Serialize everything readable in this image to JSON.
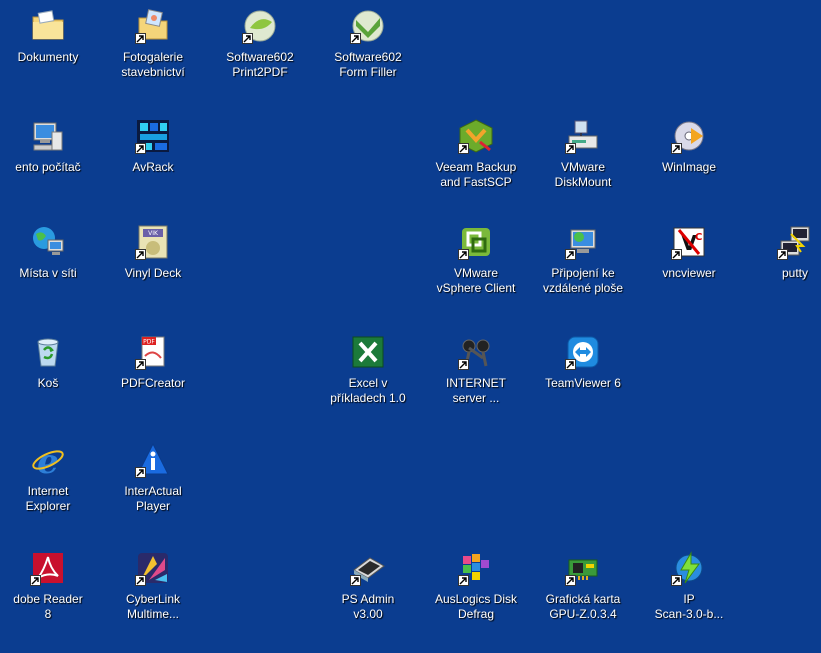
{
  "desktop": {
    "background": "#0b3d90",
    "icons": [
      {
        "id": "dokumenty",
        "label": "Dokumenty",
        "icon": "folder-icon",
        "shortcut": false
      },
      {
        "id": "fotogalerie",
        "label": "Fotogalerie\nstavebnictví",
        "icon": "photo-folder-icon",
        "shortcut": true
      },
      {
        "id": "sw602-print",
        "label": "Software602\nPrint2PDF",
        "icon": "software602-print-icon",
        "shortcut": true
      },
      {
        "id": "sw602-form",
        "label": "Software602\nForm Filler",
        "icon": "software602-form-icon",
        "shortcut": true
      },
      {
        "id": "tento-pocitac",
        "label": "ento počítač",
        "icon": "my-computer-icon",
        "shortcut": false
      },
      {
        "id": "avrack",
        "label": "AvRack",
        "icon": "avrack-icon",
        "shortcut": true
      },
      {
        "id": "veeam",
        "label": "Veeam Backup\nand FastSCP",
        "icon": "veeam-icon",
        "shortcut": true
      },
      {
        "id": "vmware-diskmount",
        "label": "VMware\nDiskMount",
        "icon": "vmware-diskmount-icon",
        "shortcut": true
      },
      {
        "id": "winimage",
        "label": "WinImage",
        "icon": "winimage-icon",
        "shortcut": true
      },
      {
        "id": "mista-v-siti",
        "label": "Místa v síti",
        "icon": "network-places-icon",
        "shortcut": false
      },
      {
        "id": "vinyl-deck",
        "label": "Vinyl Deck",
        "icon": "vinyl-deck-icon",
        "shortcut": true
      },
      {
        "id": "vsphere",
        "label": "VMware\nvSphere Client",
        "icon": "vsphere-client-icon",
        "shortcut": true
      },
      {
        "id": "pripojeni",
        "label": "Připojení ke\nvzdálené ploše",
        "icon": "remote-desktop-icon",
        "shortcut": true
      },
      {
        "id": "vncviewer",
        "label": "vncviewer",
        "icon": "vncviewer-icon",
        "shortcut": true
      },
      {
        "id": "putty",
        "label": "putty",
        "icon": "putty-icon",
        "shortcut": true
      },
      {
        "id": "kos",
        "label": "Koš",
        "icon": "recycle-bin-icon",
        "shortcut": false
      },
      {
        "id": "pdfcreator",
        "label": "PDFCreator",
        "icon": "pdfcreator-icon",
        "shortcut": true
      },
      {
        "id": "excel",
        "label": "Excel v\npříkladech 1.0",
        "icon": "excel-icon",
        "shortcut": false
      },
      {
        "id": "internet-server",
        "label": "INTERNET\nserver ...",
        "icon": "internet-server-icon",
        "shortcut": true
      },
      {
        "id": "teamviewer",
        "label": "TeamViewer 6",
        "icon": "teamviewer-icon",
        "shortcut": true
      },
      {
        "id": "ie",
        "label": "Internet\nExplorer",
        "icon": "internet-explorer-icon",
        "shortcut": false
      },
      {
        "id": "interactual",
        "label": "InterActual\nPlayer",
        "icon": "interactual-player-icon",
        "shortcut": true
      },
      {
        "id": "adobe-reader",
        "label": "dobe Reader\n8",
        "icon": "adobe-reader-icon",
        "shortcut": true
      },
      {
        "id": "cyberlink",
        "label": "CyberLink\nMultime...",
        "icon": "cyberlink-icon",
        "shortcut": true
      },
      {
        "id": "ps-admin",
        "label": "PS Admin\nv3.00",
        "icon": "ps-admin-icon",
        "shortcut": true
      },
      {
        "id": "auslogics",
        "label": "AusLogics Disk\nDefrag",
        "icon": "auslogics-defrag-icon",
        "shortcut": true
      },
      {
        "id": "gpuz",
        "label": "Grafická karta\nGPU-Z.0.3.4",
        "icon": "gpu-z-icon",
        "shortcut": true
      },
      {
        "id": "ipscan",
        "label": "IP\nScan-3.0-b...",
        "icon": "ip-scan-icon",
        "shortcut": true
      }
    ]
  }
}
